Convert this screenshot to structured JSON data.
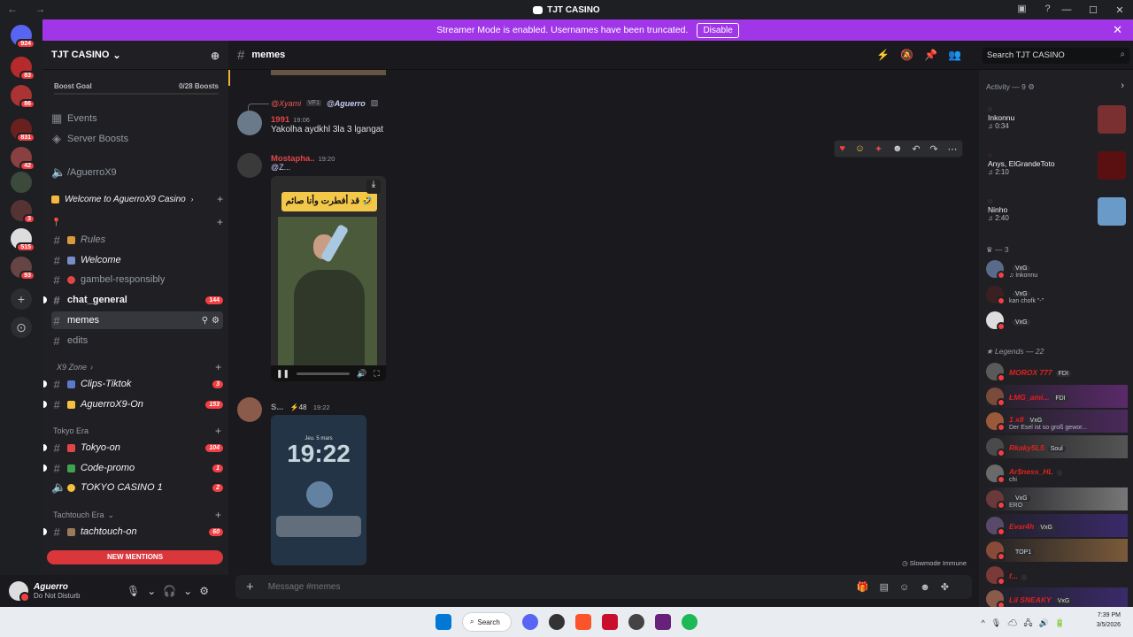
{
  "window": {
    "title": "TJT CASINO"
  },
  "banner": {
    "text": "Streamer Mode is enabled. Usernames have been truncated.",
    "button": "Disable"
  },
  "servers": {
    "badges": [
      "924",
      "83",
      "86",
      "831",
      "42",
      "3",
      "515",
      "93"
    ]
  },
  "guild": {
    "name": "TJT CASINO",
    "boost_label": "Boost Goal",
    "boost_count": "0/28 Boosts"
  },
  "sidebar": {
    "events": "Events",
    "server_boosts": "Server Boosts",
    "voice_aguerro": "/AguerroX9",
    "cat_welcome": "Welcome to AguerroX9 Casino",
    "channels": [
      {
        "name": "Rules"
      },
      {
        "name": "Welcome"
      },
      {
        "name": "gambel-responsibly"
      },
      {
        "name": "chat_general",
        "count": "144"
      },
      {
        "name": "memes"
      },
      {
        "name": "edits"
      }
    ],
    "cat_x9": "X9 Zone",
    "x9": [
      {
        "name": "Clips-Tiktok",
        "count": "3"
      },
      {
        "name": "AguerroX9-On",
        "count": "153"
      }
    ],
    "cat_tokyo": "Tokyo Era",
    "tokyo": [
      {
        "name": "Tokyo-on",
        "count": "104"
      },
      {
        "name": "Code-promo",
        "count": "1"
      },
      {
        "name": "TOKYO CASINO 1",
        "count": "2"
      }
    ],
    "cat_tachtouch": "Tachtouch Era",
    "tachtouch": [
      {
        "name": "tachtouch-on",
        "count": "60"
      }
    ],
    "new_mentions": "NEW MENTIONS"
  },
  "user": {
    "name": "Aguerro",
    "status": "Do Not Disturb"
  },
  "channel": {
    "name": "memes",
    "search_placeholder": "Search TJT CASINO"
  },
  "messages": {
    "reply_user": "@Xyami",
    "reply_badge": "VF1",
    "reply_mention": "@Aguerro",
    "m1_author": "1991",
    "m1_time": "19:06",
    "m1_text": "Yakolha aydkhl 3la 3 lgangat",
    "m2_author": "Mostapha..",
    "m2_time": "19:20",
    "m2_text": "@Z...",
    "video_caption": "قد أفطرت وأنا صائم 🤣",
    "m3_author": "S...",
    "m3_badge": "48",
    "m3_time": "19:22",
    "phone_date": "Jeu. 5 mars",
    "phone_time": "19:22"
  },
  "composer": {
    "placeholder": "Message #memes"
  },
  "slowmode": "Slowmode Immune",
  "members": {
    "activity_label": "Activity — 9",
    "activity": [
      {
        "name": "Inkonnu",
        "time": "♫ 0:34"
      },
      {
        "name": "Anys, ElGrandeToto",
        "time": "♫ 2:10"
      },
      {
        "name": "Ninho",
        "time": "♫ 2:40"
      }
    ],
    "group1_label": "— 3",
    "group1": [
      {
        "name": "",
        "tag": "VxG",
        "sub": "♫ Inkonnu"
      },
      {
        "name": "",
        "tag": "VxG",
        "sub": "kan chofk \"-\""
      },
      {
        "name": "",
        "tag": "VxG",
        "sub": ""
      }
    ],
    "legends_label": "Legends — 22",
    "legends": [
      {
        "name": "MOROX 777",
        "tag": "FDI",
        "sub": ""
      },
      {
        "name": "ŁMG_ami...",
        "tag": "FDI",
        "sub": ""
      },
      {
        "name": "1 x8",
        "tag": "VxG",
        "sub": "Der Esel ist so groß gewor..."
      },
      {
        "name": "Rkaky5L5",
        "tag": "Soul",
        "sub": ""
      },
      {
        "name": "Ar$ness_HL",
        "tag": "",
        "sub": "chi"
      },
      {
        "name": "",
        "tag": "VxG",
        "sub": "ERO"
      },
      {
        "name": "Evar4h",
        "tag": "VxG",
        "sub": ""
      },
      {
        "name": "",
        "tag": "TOP1",
        "sub": ""
      },
      {
        "name": "f...",
        "tag": "",
        "sub": ""
      },
      {
        "name": "Lil SNEAKY",
        "tag": "VxG",
        "sub": ""
      }
    ]
  },
  "taskbar": {
    "search": "Search",
    "time": "7:39 PM",
    "date": "3/5/2026"
  },
  "colors": {
    "banner": "#a036e8",
    "badge": "#f23f43",
    "mention_bar": "#da373c"
  }
}
